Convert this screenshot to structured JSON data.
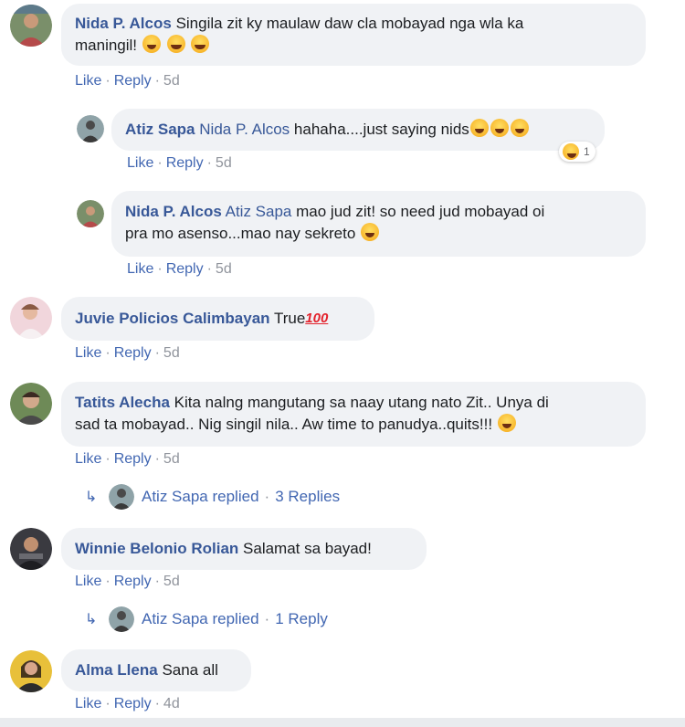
{
  "actions": {
    "like": "Like",
    "reply": "Reply",
    "sep": "·"
  },
  "comments": [
    {
      "name": "Nida P. Alcos",
      "line1": "Singila zit ky maulaw daw cla mobayad nga wla ka",
      "line2": "maningil!",
      "time": "5d"
    },
    {
      "name": "Atiz Sapa",
      "mention": "Nida P. Alcos",
      "text": "hahaha....just saying nids",
      "time": "5d",
      "reaction_count": "1"
    },
    {
      "name": "Nida P. Alcos",
      "mention": "Atiz Sapa",
      "line1": "mao jud zit! so need jud mobayad oi",
      "line2": "pra mo asenso...mao nay sekreto",
      "time": "5d"
    },
    {
      "name": "Juvie Policios Calimbayan",
      "text": "True",
      "badge": "100",
      "time": "5d"
    },
    {
      "name": "Tatits Alecha",
      "line1": "Kita nalng mangutang sa naay utang nato Zit.. Unya di",
      "line2": "sad ta mobayad.. Nig singil nila.. Aw time to panudya..quits!!!",
      "time": "5d",
      "replied": "Atiz Sapa replied",
      "replies": "3 Replies"
    },
    {
      "name": "Winnie Belonio Rolian",
      "text": "Salamat sa bayad!",
      "time": "5d",
      "replied": "Atiz Sapa replied",
      "replies": "1 Reply"
    },
    {
      "name": "Alma Llena",
      "text": "Sana all",
      "time": "4d"
    }
  ]
}
